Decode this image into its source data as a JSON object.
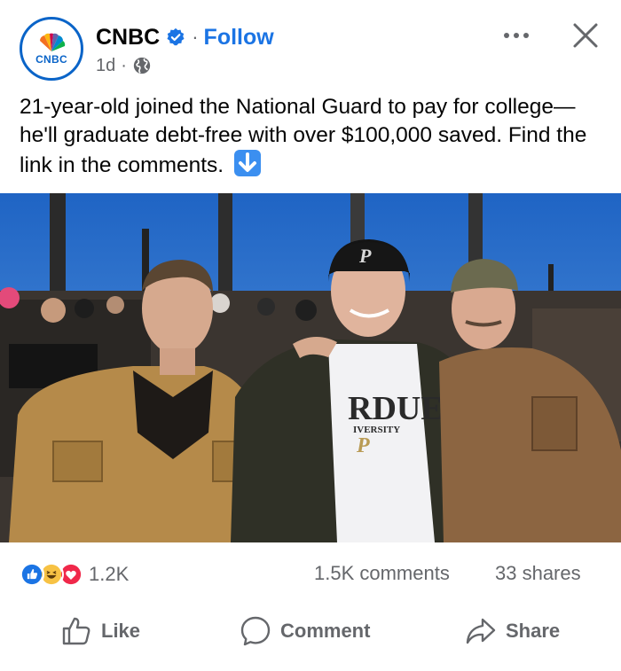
{
  "post": {
    "author": "CNBC",
    "avatar_text": "CNBC",
    "separator": "·",
    "follow_label": "Follow",
    "time": "1d",
    "meta_dot": "·",
    "caption": "21-year-old joined the National Guard to pay for college—he'll graduate debt-free with over $100,000 saved. Find the link in the comments.",
    "icons": {
      "verified": "verified-badge-icon",
      "audience": "globe-icon",
      "more": "more-horizontal-icon",
      "close": "close-icon",
      "emoji": "down-arrow-emoji-icon"
    }
  },
  "photo": {
    "hat_logo": "P",
    "hoodie_text": "RDUE",
    "hoodie_subtext": "IVERSITY",
    "hoodie_logo": "P"
  },
  "stats": {
    "reactions": [
      "like",
      "haha",
      "love"
    ],
    "reaction_count": "1.2K",
    "comments": "1.5K comments",
    "shares": "33 shares"
  },
  "actions": {
    "like": "Like",
    "comment": "Comment",
    "share": "Share"
  },
  "colors": {
    "brand_blue": "#1b74e4",
    "text_primary": "#050505",
    "text_secondary": "#65676b",
    "sky": "#2d74cf"
  }
}
